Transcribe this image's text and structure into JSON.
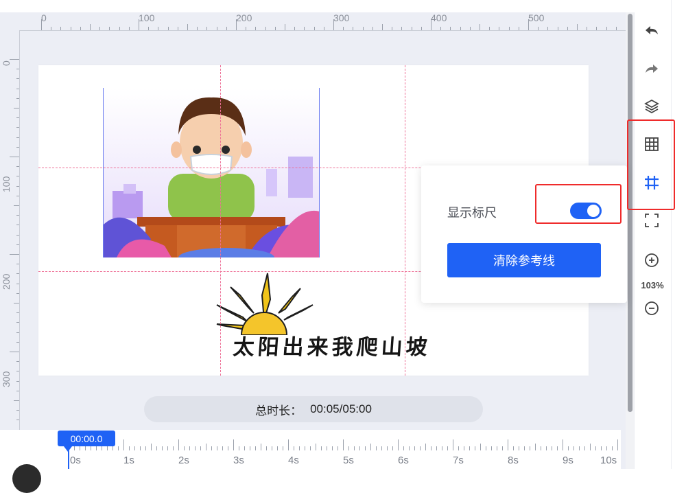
{
  "ruler": {
    "h_labels": [
      "0",
      "100",
      "200",
      "300",
      "400",
      "500"
    ],
    "v_labels": [
      "0",
      "100",
      "200",
      "300",
      "0"
    ]
  },
  "canvas": {
    "image_text": "太阳出来我爬山坡"
  },
  "duration": {
    "label": "总时长：",
    "value": "00:05/05:00"
  },
  "timeline": {
    "playhead": "00:00.0",
    "labels": [
      "0s",
      "1s",
      "2s",
      "3s",
      "4s",
      "5s",
      "6s",
      "7s",
      "8s",
      "9s",
      "10s"
    ]
  },
  "toolbar": {
    "tools": [
      "undo-icon",
      "redo-icon",
      "layers-icon",
      "grid-icon",
      "ruler-icon",
      "fullscreen-icon",
      "zoom-in-icon",
      "zoom-out-icon"
    ],
    "zoom": "103%"
  },
  "popover": {
    "ruler_label": "显示标尺",
    "ruler_on": true,
    "clear_button": "清除参考线"
  },
  "colors": {
    "accent": "#1f62f5",
    "guide": "#ee6f96",
    "highlight": "#ef2b2b"
  }
}
